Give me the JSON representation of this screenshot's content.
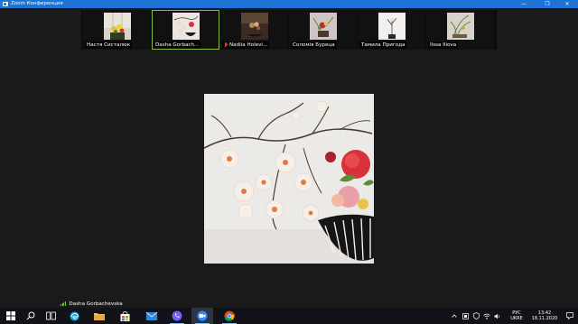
{
  "window": {
    "title": "Zoom Конференция",
    "controls": {
      "minimize": "—",
      "maximize": "❐",
      "close": "✕"
    }
  },
  "gallery": [
    {
      "name": "Настя Систалюк",
      "muted": false,
      "active": false
    },
    {
      "name": "Dasha  Gorbach...",
      "muted": false,
      "active": true
    },
    {
      "name": "Nadiia Holevi...",
      "muted": true,
      "active": false
    },
    {
      "name": "Соломія Буреца",
      "muted": false,
      "active": false
    },
    {
      "name": "Тамила Пригода",
      "muted": false,
      "active": false
    },
    {
      "name": "Ilssa Iliova",
      "muted": false,
      "active": false
    }
  ],
  "speaker": {
    "name": "Dasha  Gorbachevska"
  },
  "taskbar": {
    "apps": [
      "windows-start-icon",
      "search-icon",
      "task-view-icon",
      "edge-icon",
      "file-explorer-icon",
      "store-icon",
      "mail-icon",
      "viber-icon",
      "zoom-icon",
      "chrome-icon"
    ],
    "language": {
      "line1": "РУС",
      "line2": "UKRE"
    },
    "clock": {
      "time": "13:42",
      "date": "18.11.2020"
    }
  }
}
